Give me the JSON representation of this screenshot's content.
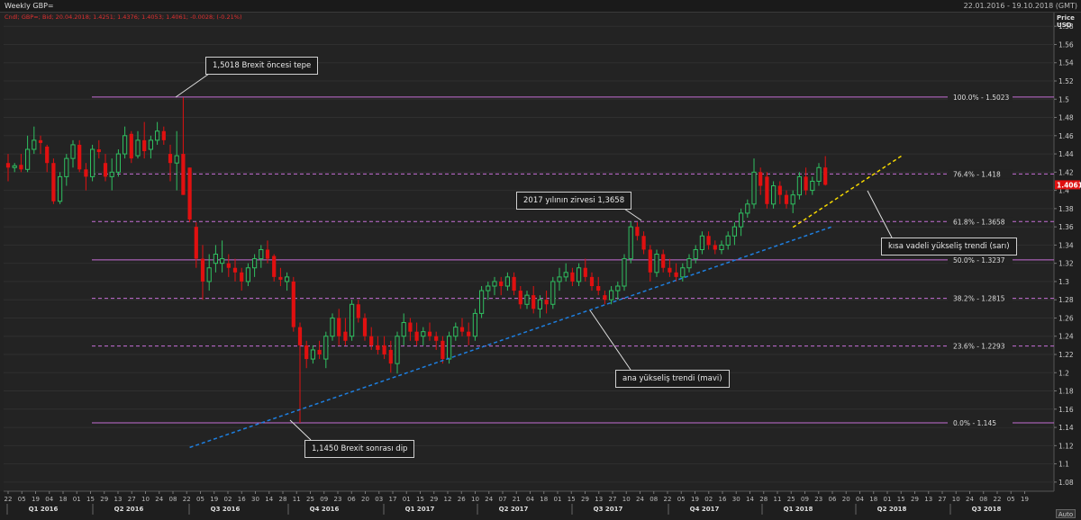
{
  "header": {
    "title": "Weekly GBP=",
    "date_range": "22.01.2016 - 19.10.2018 (GMT)",
    "legend_line": "Cndl; GBP=; Bid; 20.04.2018; 1.4251; 1.4376; 1.4053; 1.4061; -0.0028; (-0.21%)"
  },
  "axis": {
    "price_label_1": "Price",
    "price_label_2": "USD",
    "auto_button": "Auto",
    "y_ticks": [
      "1.08",
      "1.1",
      "1.12",
      "1.14",
      "1.16",
      "1.18",
      "1.2",
      "1.22",
      "1.24",
      "1.26",
      "1.28",
      "1.3",
      "1.32",
      "1.34",
      "1.36",
      "1.38",
      "1.4",
      "1.42",
      "1.44",
      "1.46",
      "1.48",
      "1.5",
      "1.52",
      "1.54",
      "1.56",
      "1.58"
    ],
    "current_price_label": "1.4061",
    "current_price_color": "#e01010"
  },
  "colors": {
    "up_candle": "#2fbf60",
    "down_candle": "#e01010",
    "fib_line": "#c66fd6",
    "main_trend": "#1e7fe0",
    "short_trend": "#f5d800"
  },
  "fib_levels": [
    {
      "pct": "100.0%",
      "value": 1.5023,
      "label": "1.5023",
      "style": "solid"
    },
    {
      "pct": "76.4%",
      "value": 1.418,
      "label": "1.418",
      "style": "dashed"
    },
    {
      "pct": "61.8%",
      "value": 1.3658,
      "label": "1.3658",
      "style": "dashed"
    },
    {
      "pct": "50.0%",
      "value": 1.3237,
      "label": "1.3237",
      "style": "solid"
    },
    {
      "pct": "38.2%",
      "value": 1.2815,
      "label": "1.2815",
      "style": "dashed"
    },
    {
      "pct": "23.6%",
      "value": 1.2293,
      "label": "1.2293",
      "style": "dashed"
    },
    {
      "pct": "0.0%",
      "value": 1.145,
      "label": "1.145",
      "style": "solid"
    }
  ],
  "annotations": {
    "pre_brexit_top": "1,5018 Brexit öncesi tepe",
    "year_2017_peak": "2017 yılının zirvesi 1,3658",
    "short_trend": "kısa vadeli yükseliş trendi (sarı)",
    "main_trend": "ana yükseliş trendi (mavi)",
    "post_brexit_low": "1,1450 Brexit sonrası dip"
  },
  "chart_data": {
    "type": "candlestick",
    "title": "Weekly GBP=",
    "ylabel": "Price USD",
    "ylim": [
      1.07,
      1.595
    ],
    "grid": true,
    "x_tick_labels": [
      "22",
      "05",
      "19",
      "04",
      "18",
      "01",
      "15",
      "29",
      "14",
      "28",
      "11",
      "25",
      "09",
      "23",
      "06",
      "20",
      "04",
      "18",
      "01",
      "15",
      "29",
      "12",
      "26",
      "10",
      "24",
      "07",
      "21",
      "05",
      "19",
      "02",
      "16",
      "30",
      "13",
      "27",
      "11",
      "25",
      "08",
      "22",
      "06",
      "20",
      "03",
      "17",
      "31",
      "14",
      "28",
      "12",
      "26",
      "09",
      "23",
      "07",
      "21",
      "04",
      "18",
      "02",
      "16",
      "30",
      "13",
      "27",
      "10",
      "24",
      "08",
      "22",
      "05",
      "19",
      "02",
      "16",
      "30",
      "14",
      "28",
      "11",
      "25",
      "09",
      "23",
      "06",
      "20",
      "03",
      "17",
      "01",
      "15",
      "29",
      "12",
      "26",
      "10",
      "24",
      "07",
      "21",
      "04",
      "18",
      "04",
      "18",
      "01",
      "15",
      "29",
      "13",
      "27",
      "10",
      "24",
      "08",
      "22",
      "05",
      "19",
      "03",
      "17",
      "31",
      "14",
      "28",
      "12",
      "26",
      "09",
      "23",
      "07",
      "21",
      "04",
      "18",
      "02",
      "16",
      "30",
      "13",
      "27",
      "11",
      "25",
      "08",
      "22",
      "06",
      "20",
      "03",
      "17",
      "01",
      "15",
      "29",
      "12",
      "26",
      "10",
      "24",
      "07",
      "21",
      "04",
      "18",
      "01",
      "15",
      "29",
      "13",
      "27",
      "10",
      "24",
      "08",
      "22",
      "05",
      "19",
      "03",
      "17",
      "31",
      "14",
      "28",
      "12",
      "26",
      "09",
      "23",
      "06",
      "20",
      "04",
      "18",
      "01",
      "15",
      "29",
      "13",
      "27",
      "10",
      "24",
      "08",
      "22",
      "05",
      "19",
      "02",
      "16",
      "30",
      "14",
      "28",
      "11",
      "25",
      "09",
      "23",
      "06",
      "20",
      "03",
      "17",
      "01",
      "15",
      "29",
      "12",
      "26",
      "09",
      "23",
      "07",
      "21",
      "04",
      "18",
      "01",
      "15",
      "29",
      "13",
      "27",
      "11",
      "25",
      "08",
      "22",
      "06",
      "20",
      "03",
      "17",
      "01",
      "15",
      "29",
      "12",
      "26",
      "10",
      "24",
      "07",
      "21",
      "05",
      "19",
      "02",
      "16",
      "30",
      "14",
      "28",
      "11",
      "25",
      "09",
      "23",
      "06",
      "20",
      "04",
      "18",
      "01",
      "15",
      "29",
      "13",
      "27",
      "10",
      "24",
      "08",
      "22",
      "06",
      "20",
      "03",
      "17",
      "01",
      "15",
      "29",
      "12",
      "26",
      "10",
      "24",
      "07",
      "21",
      "05",
      "19"
    ],
    "x_ticks_shown": [
      "22",
      "05",
      "19",
      "04",
      "18",
      "01",
      "15",
      "29",
      "13",
      "27",
      "10",
      "24",
      "08",
      "22",
      "05",
      "19",
      "02",
      "16",
      "30",
      "14",
      "28",
      "11",
      "25",
      "09",
      "23",
      "06",
      "20",
      "03",
      "17",
      "01",
      "15",
      "29",
      "12",
      "26",
      "10",
      "24",
      "07",
      "21",
      "04",
      "18",
      "01",
      "15",
      "29",
      "13",
      "27",
      "10",
      "24",
      "08",
      "22",
      "05",
      "19",
      "02",
      "16",
      "30",
      "14",
      "28",
      "11",
      "25",
      "09",
      "23",
      "06",
      "20",
      "04",
      "18",
      "01",
      "15",
      "29",
      "13",
      "27",
      "10",
      "24",
      "08",
      "22",
      "05",
      "19"
    ],
    "quarter_labels": [
      "Q1 2016",
      "Q2 2016",
      "Q3 2016",
      "Q4 2016",
      "Q1 2017",
      "Q2 2017",
      "Q3 2017",
      "Q4 2017",
      "Q1 2018",
      "Q2 2018",
      "Q3 2018"
    ],
    "candles": [
      {
        "o": 1.43,
        "h": 1.44,
        "l": 1.41,
        "c": 1.425
      },
      {
        "o": 1.425,
        "h": 1.43,
        "l": 1.42,
        "c": 1.427
      },
      {
        "o": 1.428,
        "h": 1.44,
        "l": 1.42,
        "c": 1.423
      },
      {
        "o": 1.423,
        "h": 1.46,
        "l": 1.42,
        "c": 1.445
      },
      {
        "o": 1.445,
        "h": 1.47,
        "l": 1.44,
        "c": 1.455
      },
      {
        "o": 1.455,
        "h": 1.46,
        "l": 1.44,
        "c": 1.452
      },
      {
        "o": 1.448,
        "h": 1.45,
        "l": 1.42,
        "c": 1.43
      },
      {
        "o": 1.43,
        "h": 1.435,
        "l": 1.385,
        "c": 1.388
      },
      {
        "o": 1.388,
        "h": 1.42,
        "l": 1.385,
        "c": 1.415
      },
      {
        "o": 1.415,
        "h": 1.44,
        "l": 1.405,
        "c": 1.435
      },
      {
        "o": 1.435,
        "h": 1.455,
        "l": 1.425,
        "c": 1.45
      },
      {
        "o": 1.45,
        "h": 1.455,
        "l": 1.42,
        "c": 1.423
      },
      {
        "o": 1.423,
        "h": 1.43,
        "l": 1.4,
        "c": 1.415
      },
      {
        "o": 1.415,
        "h": 1.45,
        "l": 1.41,
        "c": 1.445
      },
      {
        "o": 1.445,
        "h": 1.455,
        "l": 1.435,
        "c": 1.442
      },
      {
        "o": 1.43,
        "h": 1.44,
        "l": 1.41,
        "c": 1.415
      },
      {
        "o": 1.415,
        "h": 1.435,
        "l": 1.4,
        "c": 1.42
      },
      {
        "o": 1.42,
        "h": 1.445,
        "l": 1.415,
        "c": 1.44
      },
      {
        "o": 1.44,
        "h": 1.47,
        "l": 1.435,
        "c": 1.46
      },
      {
        "o": 1.462,
        "h": 1.465,
        "l": 1.43,
        "c": 1.435
      },
      {
        "o": 1.438,
        "h": 1.465,
        "l": 1.435,
        "c": 1.455
      },
      {
        "o": 1.455,
        "h": 1.475,
        "l": 1.435,
        "c": 1.443
      },
      {
        "o": 1.445,
        "h": 1.46,
        "l": 1.435,
        "c": 1.455
      },
      {
        "o": 1.455,
        "h": 1.475,
        "l": 1.45,
        "c": 1.465
      },
      {
        "o": 1.465,
        "h": 1.47,
        "l": 1.45,
        "c": 1.455
      },
      {
        "o": 1.44,
        "h": 1.45,
        "l": 1.41,
        "c": 1.43
      },
      {
        "o": 1.43,
        "h": 1.465,
        "l": 1.4,
        "c": 1.438
      },
      {
        "o": 1.44,
        "h": 1.5018,
        "l": 1.395,
        "c": 1.395
      },
      {
        "o": 1.425,
        "h": 1.425,
        "l": 1.365,
        "c": 1.368
      },
      {
        "o": 1.36,
        "h": 1.365,
        "l": 1.315,
        "c": 1.325
      },
      {
        "o": 1.325,
        "h": 1.34,
        "l": 1.28,
        "c": 1.3
      },
      {
        "o": 1.3,
        "h": 1.33,
        "l": 1.29,
        "c": 1.315
      },
      {
        "o": 1.32,
        "h": 1.34,
        "l": 1.31,
        "c": 1.33
      },
      {
        "o": 1.32,
        "h": 1.345,
        "l": 1.31,
        "c": 1.325
      },
      {
        "o": 1.32,
        "h": 1.33,
        "l": 1.305,
        "c": 1.315
      },
      {
        "o": 1.315,
        "h": 1.325,
        "l": 1.3,
        "c": 1.31
      },
      {
        "o": 1.31,
        "h": 1.315,
        "l": 1.29,
        "c": 1.3
      },
      {
        "o": 1.3,
        "h": 1.32,
        "l": 1.295,
        "c": 1.315
      },
      {
        "o": 1.315,
        "h": 1.33,
        "l": 1.305,
        "c": 1.325
      },
      {
        "o": 1.325,
        "h": 1.34,
        "l": 1.315,
        "c": 1.335
      },
      {
        "o": 1.335,
        "h": 1.345,
        "l": 1.32,
        "c": 1.325
      },
      {
        "o": 1.328,
        "h": 1.33,
        "l": 1.3,
        "c": 1.305
      },
      {
        "o": 1.305,
        "h": 1.315,
        "l": 1.295,
        "c": 1.302
      },
      {
        "o": 1.3,
        "h": 1.31,
        "l": 1.29,
        "c": 1.305
      },
      {
        "o": 1.3,
        "h": 1.305,
        "l": 1.245,
        "c": 1.25
      },
      {
        "o": 1.25,
        "h": 1.255,
        "l": 1.145,
        "c": 1.23
      },
      {
        "o": 1.23,
        "h": 1.235,
        "l": 1.205,
        "c": 1.215
      },
      {
        "o": 1.215,
        "h": 1.23,
        "l": 1.21,
        "c": 1.225
      },
      {
        "o": 1.225,
        "h": 1.235,
        "l": 1.215,
        "c": 1.22
      },
      {
        "o": 1.215,
        "h": 1.245,
        "l": 1.205,
        "c": 1.24
      },
      {
        "o": 1.24,
        "h": 1.265,
        "l": 1.235,
        "c": 1.26
      },
      {
        "o": 1.26,
        "h": 1.27,
        "l": 1.23,
        "c": 1.24
      },
      {
        "o": 1.245,
        "h": 1.26,
        "l": 1.23,
        "c": 1.235
      },
      {
        "o": 1.24,
        "h": 1.28,
        "l": 1.235,
        "c": 1.275
      },
      {
        "o": 1.275,
        "h": 1.28,
        "l": 1.255,
        "c": 1.26
      },
      {
        "o": 1.26,
        "h": 1.265,
        "l": 1.235,
        "c": 1.24
      },
      {
        "o": 1.24,
        "h": 1.25,
        "l": 1.225,
        "c": 1.23
      },
      {
        "o": 1.23,
        "h": 1.24,
        "l": 1.22,
        "c": 1.225
      },
      {
        "o": 1.23,
        "h": 1.24,
        "l": 1.215,
        "c": 1.22
      },
      {
        "o": 1.225,
        "h": 1.235,
        "l": 1.2,
        "c": 1.21
      },
      {
        "o": 1.21,
        "h": 1.245,
        "l": 1.199,
        "c": 1.24
      },
      {
        "o": 1.24,
        "h": 1.265,
        "l": 1.23,
        "c": 1.255
      },
      {
        "o": 1.255,
        "h": 1.26,
        "l": 1.235,
        "c": 1.245
      },
      {
        "o": 1.245,
        "h": 1.255,
        "l": 1.23,
        "c": 1.235
      },
      {
        "o": 1.24,
        "h": 1.25,
        "l": 1.23,
        "c": 1.245
      },
      {
        "o": 1.245,
        "h": 1.255,
        "l": 1.235,
        "c": 1.24
      },
      {
        "o": 1.24,
        "h": 1.245,
        "l": 1.225,
        "c": 1.235
      },
      {
        "o": 1.235,
        "h": 1.24,
        "l": 1.21,
        "c": 1.215
      },
      {
        "o": 1.215,
        "h": 1.245,
        "l": 1.21,
        "c": 1.24
      },
      {
        "o": 1.24,
        "h": 1.255,
        "l": 1.235,
        "c": 1.25
      },
      {
        "o": 1.25,
        "h": 1.26,
        "l": 1.24,
        "c": 1.245
      },
      {
        "o": 1.245,
        "h": 1.255,
        "l": 1.23,
        "c": 1.24
      },
      {
        "o": 1.24,
        "h": 1.27,
        "l": 1.235,
        "c": 1.265
      },
      {
        "o": 1.265,
        "h": 1.295,
        "l": 1.26,
        "c": 1.29
      },
      {
        "o": 1.29,
        "h": 1.3,
        "l": 1.28,
        "c": 1.295
      },
      {
        "o": 1.295,
        "h": 1.305,
        "l": 1.285,
        "c": 1.3
      },
      {
        "o": 1.3,
        "h": 1.305,
        "l": 1.285,
        "c": 1.295
      },
      {
        "o": 1.295,
        "h": 1.31,
        "l": 1.29,
        "c": 1.305
      },
      {
        "o": 1.305,
        "h": 1.31,
        "l": 1.285,
        "c": 1.29
      },
      {
        "o": 1.29,
        "h": 1.295,
        "l": 1.27,
        "c": 1.275
      },
      {
        "o": 1.275,
        "h": 1.29,
        "l": 1.27,
        "c": 1.285
      },
      {
        "o": 1.285,
        "h": 1.295,
        "l": 1.265,
        "c": 1.27
      },
      {
        "o": 1.27,
        "h": 1.285,
        "l": 1.26,
        "c": 1.28
      },
      {
        "o": 1.28,
        "h": 1.29,
        "l": 1.265,
        "c": 1.275
      },
      {
        "o": 1.275,
        "h": 1.305,
        "l": 1.27,
        "c": 1.3
      },
      {
        "o": 1.3,
        "h": 1.315,
        "l": 1.29,
        "c": 1.305
      },
      {
        "o": 1.305,
        "h": 1.32,
        "l": 1.3,
        "c": 1.31
      },
      {
        "o": 1.31,
        "h": 1.315,
        "l": 1.295,
        "c": 1.3
      },
      {
        "o": 1.3,
        "h": 1.32,
        "l": 1.295,
        "c": 1.315
      },
      {
        "o": 1.315,
        "h": 1.325,
        "l": 1.3,
        "c": 1.305
      },
      {
        "o": 1.305,
        "h": 1.31,
        "l": 1.29,
        "c": 1.295
      },
      {
        "o": 1.295,
        "h": 1.305,
        "l": 1.285,
        "c": 1.29
      },
      {
        "o": 1.285,
        "h": 1.29,
        "l": 1.275,
        "c": 1.28
      },
      {
        "o": 1.28,
        "h": 1.295,
        "l": 1.275,
        "c": 1.29
      },
      {
        "o": 1.29,
        "h": 1.3,
        "l": 1.28,
        "c": 1.295
      },
      {
        "o": 1.295,
        "h": 1.33,
        "l": 1.29,
        "c": 1.325
      },
      {
        "o": 1.325,
        "h": 1.3658,
        "l": 1.32,
        "c": 1.36
      },
      {
        "o": 1.36,
        "h": 1.365,
        "l": 1.345,
        "c": 1.35
      },
      {
        "o": 1.35,
        "h": 1.355,
        "l": 1.33,
        "c": 1.335
      },
      {
        "o": 1.335,
        "h": 1.34,
        "l": 1.3,
        "c": 1.31
      },
      {
        "o": 1.31,
        "h": 1.335,
        "l": 1.305,
        "c": 1.33
      },
      {
        "o": 1.33,
        "h": 1.335,
        "l": 1.31,
        "c": 1.315
      },
      {
        "o": 1.315,
        "h": 1.325,
        "l": 1.305,
        "c": 1.31
      },
      {
        "o": 1.31,
        "h": 1.32,
        "l": 1.3,
        "c": 1.305
      },
      {
        "o": 1.305,
        "h": 1.32,
        "l": 1.3,
        "c": 1.315
      },
      {
        "o": 1.315,
        "h": 1.33,
        "l": 1.31,
        "c": 1.325
      },
      {
        "o": 1.325,
        "h": 1.34,
        "l": 1.32,
        "c": 1.335
      },
      {
        "o": 1.335,
        "h": 1.355,
        "l": 1.33,
        "c": 1.35
      },
      {
        "o": 1.35,
        "h": 1.355,
        "l": 1.335,
        "c": 1.34
      },
      {
        "o": 1.34,
        "h": 1.345,
        "l": 1.33,
        "c": 1.335
      },
      {
        "o": 1.335,
        "h": 1.345,
        "l": 1.33,
        "c": 1.34
      },
      {
        "o": 1.34,
        "h": 1.355,
        "l": 1.335,
        "c": 1.35
      },
      {
        "o": 1.35,
        "h": 1.365,
        "l": 1.34,
        "c": 1.36
      },
      {
        "o": 1.36,
        "h": 1.38,
        "l": 1.35,
        "c": 1.375
      },
      {
        "o": 1.375,
        "h": 1.39,
        "l": 1.37,
        "c": 1.385
      },
      {
        "o": 1.385,
        "h": 1.435,
        "l": 1.38,
        "c": 1.42
      },
      {
        "o": 1.42,
        "h": 1.425,
        "l": 1.395,
        "c": 1.405
      },
      {
        "o": 1.415,
        "h": 1.42,
        "l": 1.38,
        "c": 1.385
      },
      {
        "o": 1.385,
        "h": 1.41,
        "l": 1.38,
        "c": 1.405
      },
      {
        "o": 1.405,
        "h": 1.41,
        "l": 1.385,
        "c": 1.395
      },
      {
        "o": 1.395,
        "h": 1.4,
        "l": 1.38,
        "c": 1.385
      },
      {
        "o": 1.385,
        "h": 1.4,
        "l": 1.375,
        "c": 1.395
      },
      {
        "o": 1.395,
        "h": 1.42,
        "l": 1.39,
        "c": 1.415
      },
      {
        "o": 1.415,
        "h": 1.425,
        "l": 1.395,
        "c": 1.4
      },
      {
        "o": 1.4,
        "h": 1.415,
        "l": 1.395,
        "c": 1.41
      },
      {
        "o": 1.41,
        "h": 1.43,
        "l": 1.405,
        "c": 1.425
      },
      {
        "o": 1.4251,
        "h": 1.4376,
        "l": 1.4053,
        "c": 1.4061
      }
    ]
  }
}
